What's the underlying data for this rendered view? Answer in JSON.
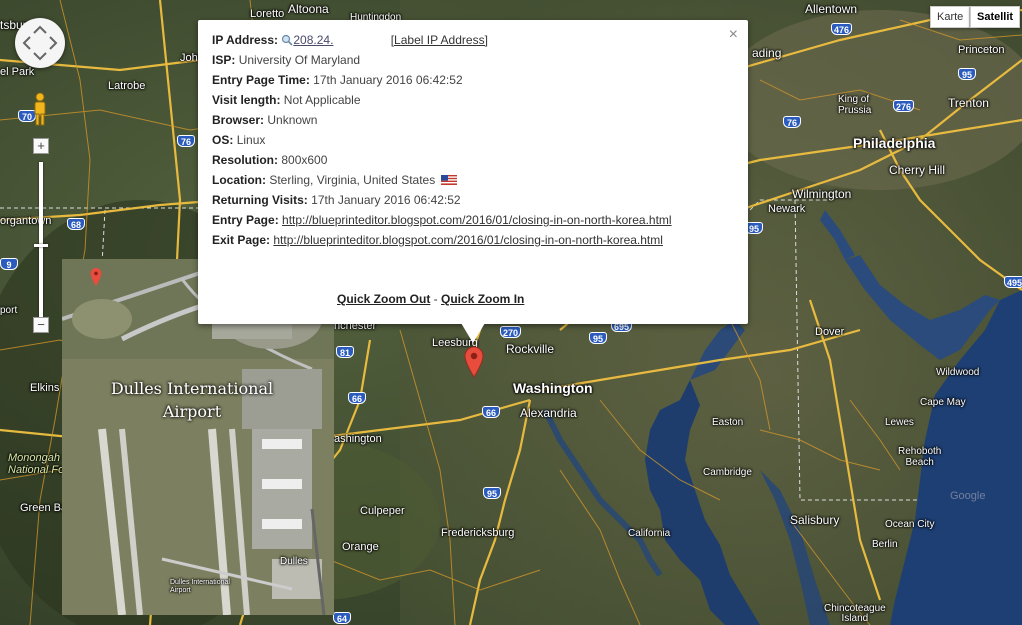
{
  "map_type": {
    "map_label": "Karte",
    "satellite_label": "Satellit",
    "active": "Satellit"
  },
  "controls": {
    "zoom_in": "+",
    "zoom_out": "−"
  },
  "inset": {
    "title_line1": "Dulles International",
    "title_line2": "Airport",
    "terminal_label": "Dulles",
    "airport_small": "Dulles International Airport"
  },
  "info": {
    "ip_label": "IP Address:",
    "ip_value": "208.24.",
    "label_ip_link": "[Label IP Address]",
    "isp_label": "ISP:",
    "isp_value": "University Of Maryland",
    "entry_time_label": "Entry Page Time:",
    "entry_time_value": "17th January 2016 06:42:52",
    "visit_length_label": "Visit length:",
    "visit_length_value": "Not Applicable",
    "browser_label": "Browser:",
    "browser_value": "Unknown",
    "os_label": "OS:",
    "os_value": "Linux",
    "resolution_label": "Resolution:",
    "resolution_value": "800x600",
    "location_label": "Location:",
    "location_value": "Sterling, Virginia, United States",
    "returning_label": "Returning Visits:",
    "returning_value": "17th January 2016 06:42:52",
    "entry_page_label": "Entry Page:",
    "entry_page_url": "http://blueprinteditor.blogspot.com/2016/01/closing-in-on-north-korea.html",
    "exit_page_label": "Exit Page:",
    "exit_page_url": "http://blueprinteditor.blogspot.com/2016/01/closing-in-on-north-korea.html",
    "zoom_out": "Quick Zoom Out",
    "zoom_separator": " - ",
    "zoom_in": "Quick Zoom In",
    "close": "×"
  },
  "places": {
    "allentown": "Allentown",
    "princeton": "Princeton",
    "trenton": "Trenton",
    "philadelphia": "Philadelphia",
    "cherry_hill": "Cherry Hill",
    "king_of_prussia": "King of\nPrussia",
    "wilmington": "Wilmington",
    "newark": "Newark",
    "dover": "Dover",
    "wildwood": "Wildwood",
    "cape_may": "Cape May",
    "lewes": "Lewes",
    "rehoboth": "Rehoboth\nBeach",
    "ocean_city": "Ocean City",
    "salisbury": "Salisbury",
    "berlin": "Berlin",
    "easton": "Easton",
    "cambridge": "Cambridge",
    "california": "California",
    "chincoteague": "Chincoteague\nIsland",
    "washington": "Washington",
    "alexandria": "Alexandria",
    "rockville": "Rockville",
    "leesburg": "Leesburg",
    "fredericksburg": "Fredericksburg",
    "culpeper": "Culpeper",
    "orange": "Orange",
    "washington_va": "ashington",
    "winchester": "nchester",
    "loretto": "Loretto",
    "altoona": "Altoona",
    "huntingdon": "Huntingdon",
    "latrobe": "Latrobe",
    "johnstown": "Johnst",
    "morgantown": "organtown",
    "elkins": "Elkins",
    "monongahela": "Monongah\nNational Fo",
    "green_bank": "Green Ban",
    "reading": "ading",
    "mount_park": "el Park",
    "port": "port",
    "tsburg": "tsburg",
    "pa_edge": "Pa",
    "google": "Google"
  },
  "shields": {
    "i476": "476",
    "i95a": "95",
    "i276": "276",
    "i76a": "76",
    "i76b": "76",
    "i70": "70",
    "i68": "68",
    "i81": "81",
    "i66": "66",
    "i270": "270",
    "i95b": "95",
    "i695": "695",
    "i95c": "95",
    "i95d": "95",
    "i66b": "66",
    "i495": "495",
    "i64": "64",
    "i9": "9",
    "us50": "50",
    "us606": "606",
    "us28": "28"
  },
  "colors": {
    "water": "#1e3f73",
    "land": "#3f4c30",
    "road_major": "#f0c040",
    "road_minor": "#d99a2a",
    "pin": "#e74c3c"
  }
}
